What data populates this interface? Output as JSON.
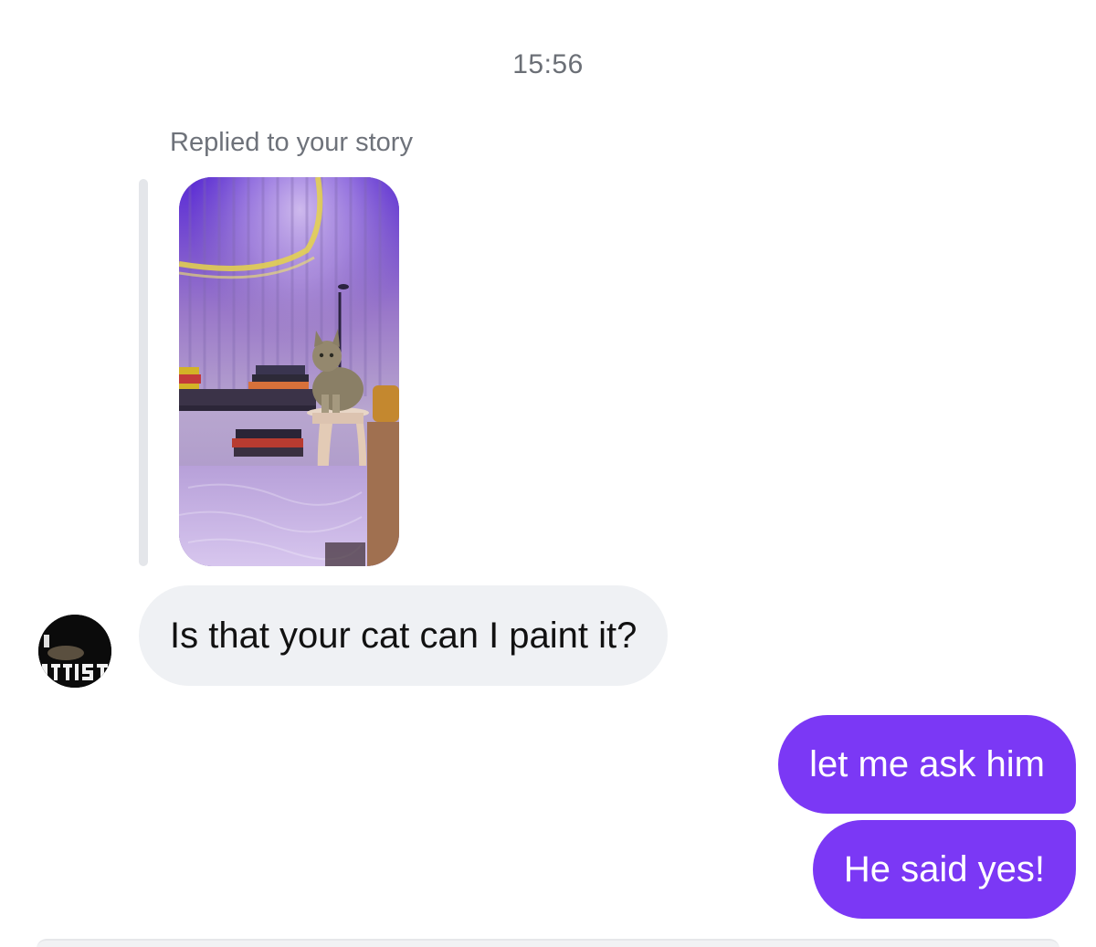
{
  "thread": {
    "timestamp": "15:56",
    "reply_context": "Replied to your story",
    "messages": [
      {
        "direction": "incoming",
        "text": "Is that your cat can I paint it?"
      },
      {
        "direction": "outgoing",
        "text": "let me ask him"
      },
      {
        "direction": "outgoing",
        "text": "He said yes!"
      }
    ]
  },
  "avatar": {
    "text": "RTIST"
  },
  "colors": {
    "outgoing_bubble": "#7b38f5",
    "incoming_bubble": "#eff1f4",
    "secondary_text": "#6e727a"
  }
}
